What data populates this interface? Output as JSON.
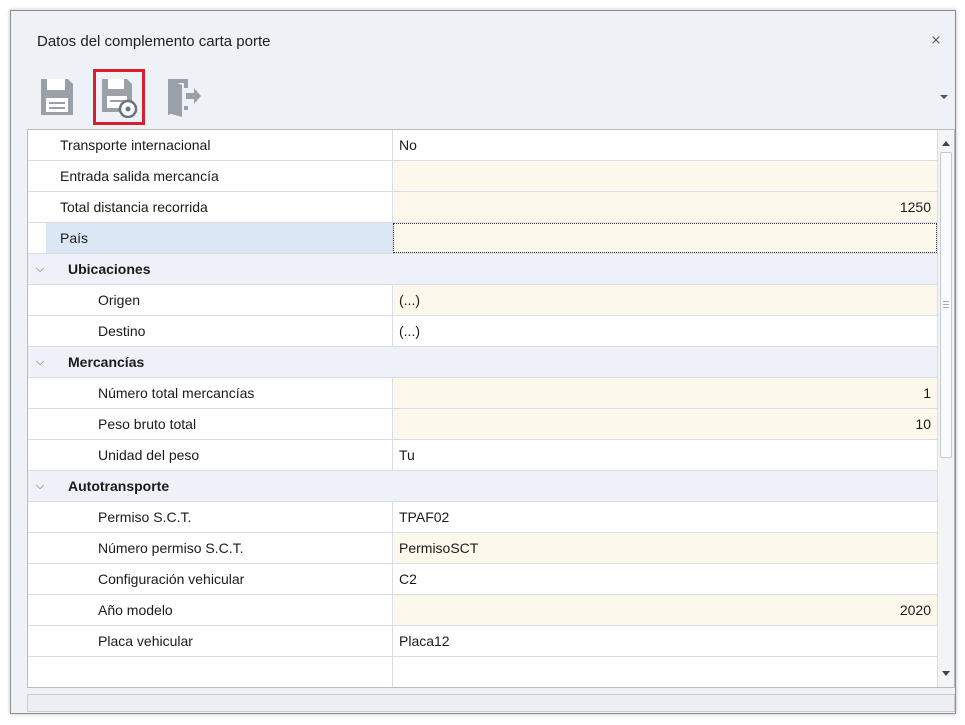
{
  "window": {
    "title": "Datos del complemento carta porte",
    "close_icon": "close-icon"
  },
  "toolbar": {
    "buttons": [
      {
        "icon": "save-icon",
        "selected": false
      },
      {
        "icon": "save-and-close-icon",
        "selected": true
      },
      {
        "icon": "exit-icon",
        "selected": false
      }
    ],
    "accent_color": "#d6202f"
  },
  "grid": {
    "rows": {
      "transporte_internacional": {
        "label": "Transporte internacional",
        "value": "No"
      },
      "entrada_salida": {
        "label": "Entrada salida mercancía",
        "value": ""
      },
      "total_distancia": {
        "label": "Total distancia recorrida",
        "value": "1250"
      },
      "pais": {
        "label": "País",
        "value": ""
      }
    },
    "categories": {
      "ubicaciones": {
        "title": "Ubicaciones",
        "origen": {
          "label": "Origen",
          "value": "(...)"
        },
        "destino": {
          "label": "Destino",
          "value": "(...)"
        }
      },
      "mercancias": {
        "title": "Mercancías",
        "numero_total": {
          "label": "Número total mercancías",
          "value": "1"
        },
        "peso_bruto": {
          "label": "Peso bruto total",
          "value": "10"
        },
        "unidad_peso": {
          "label": "Unidad del peso",
          "value": "Tu"
        }
      },
      "autotransporte": {
        "title": "Autotransporte",
        "permiso_sct": {
          "label": "Permiso S.C.T.",
          "value": "TPAF02"
        },
        "numero_permiso": {
          "label": "Número permiso S.C.T.",
          "value": "PermisoSCT"
        },
        "configuracion": {
          "label": "Configuración vehicular",
          "value": "C2"
        },
        "anio_modelo": {
          "label": "Año modelo",
          "value": "2020"
        },
        "placa": {
          "label": "Placa vehicular",
          "value": "Placa12"
        }
      }
    }
  },
  "colors": {
    "editable_value_bg": "#fdf8ec",
    "focused_label_bg": "#dbe6f4",
    "category_bg": "#eef2f8"
  }
}
